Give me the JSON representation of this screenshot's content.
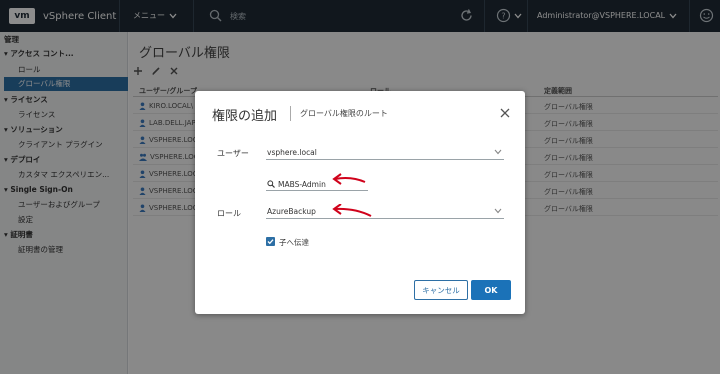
{
  "header": {
    "logo": "vm",
    "app_title": "vSphere Client",
    "menu_label": "メニュー",
    "search_placeholder": "検索",
    "user_label": "Administrator@VSPHERE.LOCAL"
  },
  "sidebar": {
    "items": [
      {
        "label": "管理",
        "kind": "root"
      },
      {
        "label": "▾ アクセス コント...",
        "kind": "head"
      },
      {
        "label": "ロール",
        "kind": "sub"
      },
      {
        "label": "グローバル権限",
        "kind": "sub",
        "active": true
      },
      {
        "label": "▾ ライセンス",
        "kind": "head"
      },
      {
        "label": "ライセンス",
        "kind": "sub"
      },
      {
        "label": "▾ ソリューション",
        "kind": "head"
      },
      {
        "label": "クライアント プラグイン",
        "kind": "sub"
      },
      {
        "label": "▾ デプロイ",
        "kind": "head"
      },
      {
        "label": "カスタマ エクスペリエン...",
        "kind": "sub"
      },
      {
        "label": "▾ Single Sign-On",
        "kind": "head"
      },
      {
        "label": "ユーザーおよびグループ",
        "kind": "sub"
      },
      {
        "label": "設定",
        "kind": "sub"
      },
      {
        "label": "▾ 証明書",
        "kind": "head"
      },
      {
        "label": "証明書の管理",
        "kind": "sub"
      }
    ]
  },
  "main": {
    "page_title": "グローバル権限",
    "columns": [
      "ユーザー/グループ",
      "ロール",
      "定義範囲"
    ],
    "rows": [
      {
        "user": "KIRO.LOCAL\\",
        "scope": "グローバル権限"
      },
      {
        "user": "LAB.DELL.JAPA",
        "scope": "グローバル権限"
      },
      {
        "user": "VSPHERE.LOCA",
        "scope": "グローバル権限"
      },
      {
        "user": "VSPHERE.LOCA",
        "scope": "グローバル権限"
      },
      {
        "user": "VSPHERE.LOCA",
        "scope": "グローバル権限"
      },
      {
        "user": "VSPHERE.LOCA",
        "scope": "グローバル権限"
      },
      {
        "user": "VSPHERE.LOCA",
        "scope": "グローバル権限"
      }
    ]
  },
  "modal": {
    "title": "権限の追加",
    "subtitle": "グローバル権限のルート",
    "user_label": "ユーザー",
    "domain_value": "vsphere.local",
    "user_search_value": "MABS-Admin",
    "role_label": "ロール",
    "role_value": "AzureBackup",
    "propagate_label": "子へ伝達",
    "propagate_checked": true,
    "cancel_label": "キャンセル",
    "ok_label": "OK"
  },
  "colors": {
    "header_bg": "#1f2b36",
    "accent": "#1b72b8",
    "arrow": "#d0021b"
  }
}
